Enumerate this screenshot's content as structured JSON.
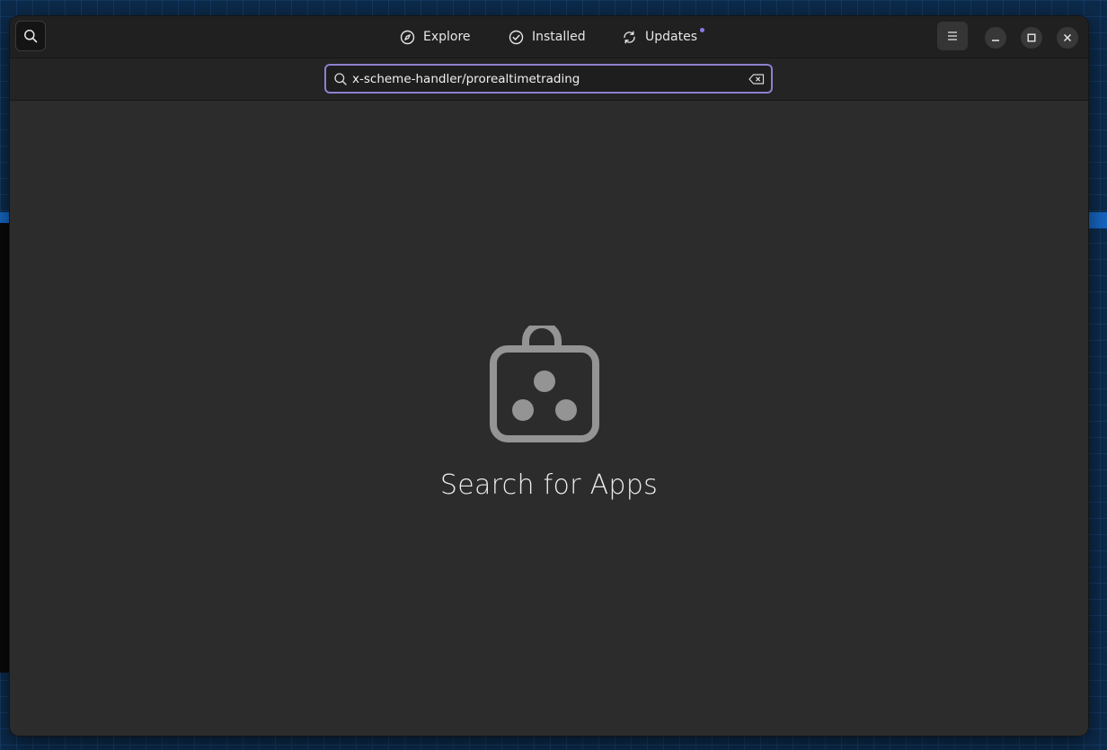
{
  "header": {
    "tabs": [
      {
        "label": "Explore",
        "icon": "compass-icon"
      },
      {
        "label": "Installed",
        "icon": "check-circle-icon"
      },
      {
        "label": "Updates",
        "icon": "refresh-icon",
        "has_badge": true
      }
    ],
    "icons": {
      "search_toggle": "search-icon",
      "menu": "hamburger-menu-icon",
      "minimize": "minimize-icon",
      "maximize": "maximize-icon",
      "close": "close-icon"
    }
  },
  "search": {
    "value": "x-scheme-handler/prorealtimetrading",
    "icon": "search-icon",
    "clear_icon": "backspace-clear-icon"
  },
  "empty_state": {
    "icon": "shopping-bag-icon",
    "title": "Search for Apps"
  },
  "colors": {
    "accent": "#8f7fcf",
    "badge": "#8a7ae6",
    "window_bg": "#2c2c2c",
    "header_bg": "#202020"
  }
}
